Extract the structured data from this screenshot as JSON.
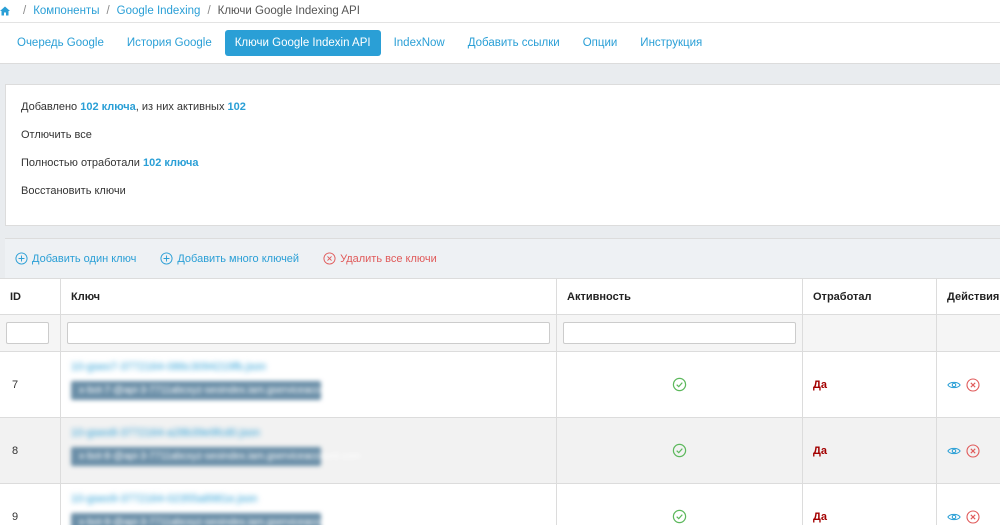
{
  "breadcrumb": {
    "items": [
      "Компоненты",
      "Google Indexing"
    ],
    "current": "Ключи Google Indexing API",
    "separator": "/"
  },
  "tabs": [
    {
      "label": "Очередь Google",
      "active": false
    },
    {
      "label": "История Google",
      "active": false
    },
    {
      "label": "Ключи Google Indexin API",
      "active": true
    },
    {
      "label": "IndexNow",
      "active": false
    },
    {
      "label": "Добавить ссылки",
      "active": false
    },
    {
      "label": "Опции",
      "active": false
    },
    {
      "label": "Инструкция",
      "active": false
    }
  ],
  "info": {
    "added_prefix": "Добавлено",
    "added_count": "102 ключа",
    "active_prefix": ", из них активных",
    "active_count": "102",
    "disable_all": "Отлючить все",
    "worked_prefix": "Полностью отработали",
    "worked_count": "102 ключа",
    "restore": "Восстановить ключи"
  },
  "actions": {
    "add_one": "Добавить один ключ",
    "add_many": "Добавить много ключей",
    "delete_all": "Удалить все ключи"
  },
  "table": {
    "columns": [
      "ID",
      "Ключ",
      "Активность",
      "Отработал",
      "Действия"
    ],
    "rows": [
      {
        "id": "7",
        "done": "Да"
      },
      {
        "id": "8",
        "done": "Да"
      },
      {
        "id": "9",
        "done": "Да"
      }
    ]
  },
  "colors": {
    "accent": "#2a9fd6",
    "danger": "#e05a5a",
    "success": "#5cb85c",
    "done": "#a30000"
  }
}
